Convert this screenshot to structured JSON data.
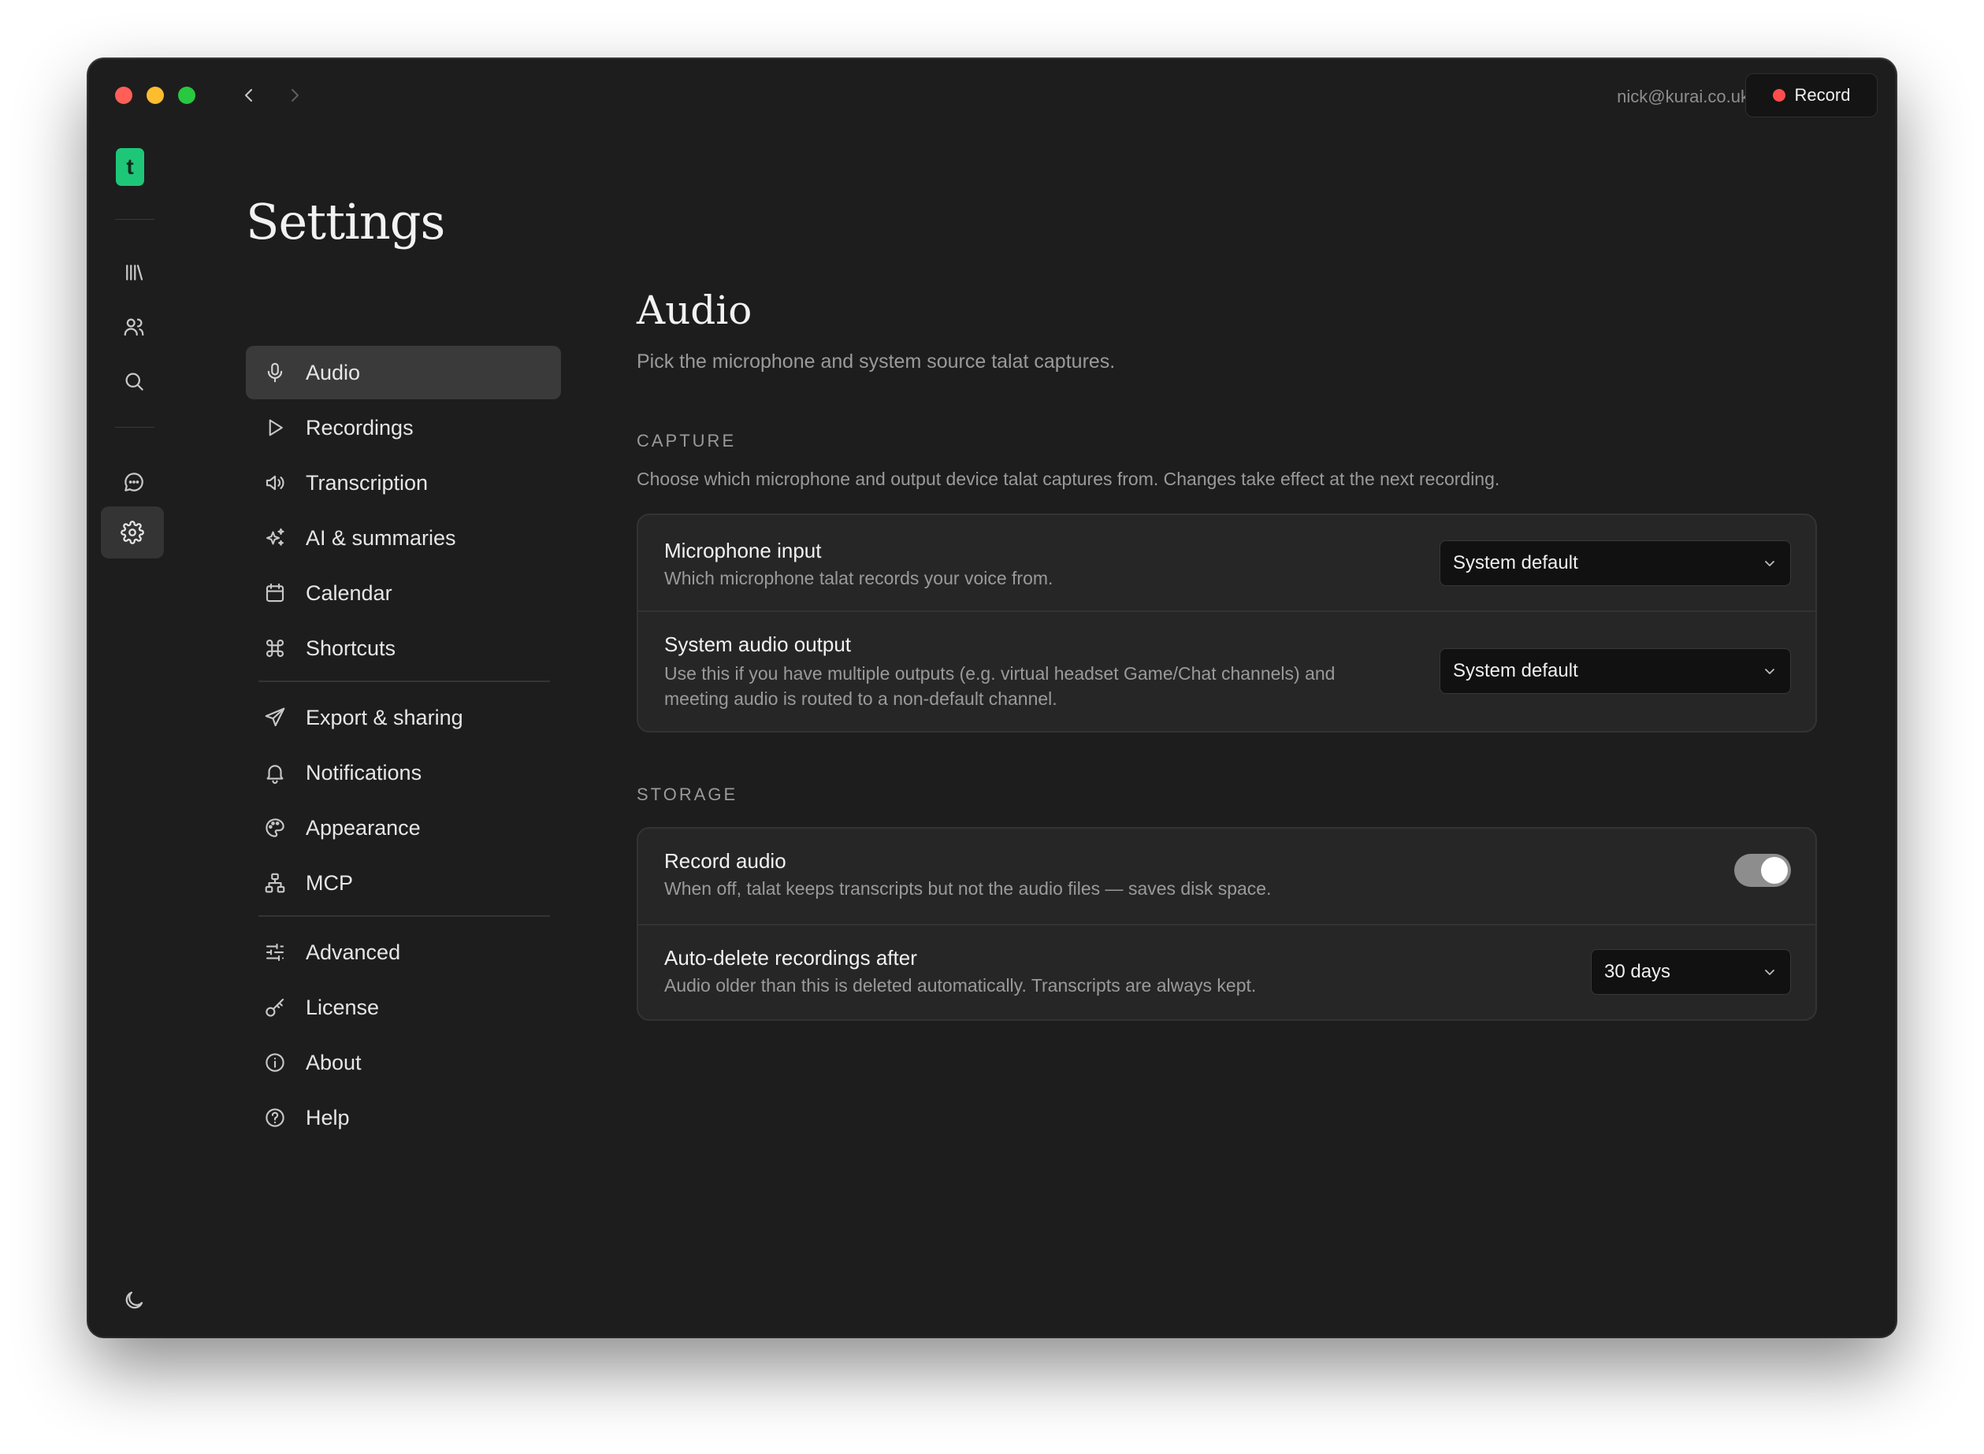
{
  "titlebar": {
    "user_email": "nick@kurai.co.uk",
    "record_label": "Record"
  },
  "rail": {
    "logo_letter": "t",
    "items": [
      "library-icon",
      "people-icon",
      "search-icon",
      "chat-icon",
      "gear-icon"
    ],
    "theme_icon": "moon-icon"
  },
  "settings": {
    "title": "Settings",
    "nav": [
      {
        "label": "Audio",
        "icon": "microphone-icon",
        "active": true
      },
      {
        "label": "Recordings",
        "icon": "play-icon"
      },
      {
        "label": "Transcription",
        "icon": "speaker-icon"
      },
      {
        "label": "AI & summaries",
        "icon": "sparkles-icon"
      },
      {
        "label": "Calendar",
        "icon": "calendar-icon"
      },
      {
        "label": "Shortcuts",
        "icon": "command-icon"
      },
      {
        "label": "Export & sharing",
        "icon": "send-icon"
      },
      {
        "label": "Notifications",
        "icon": "bell-icon"
      },
      {
        "label": "Appearance",
        "icon": "palette-icon"
      },
      {
        "label": "MCP",
        "icon": "network-icon"
      },
      {
        "label": "Advanced",
        "icon": "sliders-icon"
      },
      {
        "label": "License",
        "icon": "key-icon"
      },
      {
        "label": "About",
        "icon": "info-icon"
      },
      {
        "label": "Help",
        "icon": "help-icon"
      }
    ]
  },
  "main": {
    "title": "Audio",
    "subtitle": "Pick the microphone and system source talat captures.",
    "capture": {
      "label": "CAPTURE",
      "description": "Choose which microphone and output device talat captures from. Changes take effect at the next recording.",
      "mic": {
        "title": "Microphone input",
        "desc": "Which microphone talat records your voice from.",
        "value": "System default"
      },
      "output": {
        "title": "System audio output",
        "desc_line1": "Use this if you have multiple outputs (e.g. virtual headset Game/Chat channels) and",
        "desc_line2": "meeting audio is routed to a non-default channel.",
        "value": "System default"
      }
    },
    "storage": {
      "label": "STORAGE",
      "record_audio": {
        "title": "Record audio",
        "desc": "When off, talat keeps transcripts but not the audio files — saves disk space.",
        "enabled": true
      },
      "auto_delete": {
        "title": "Auto-delete recordings after",
        "desc": "Audio older than this is deleted automatically. Transcripts are always kept.",
        "value": "30 days"
      }
    }
  },
  "colors": {
    "window_bg": "#1d1d1d",
    "accent_logo": "#1ec778",
    "record_dot": "#ff4d4d"
  }
}
